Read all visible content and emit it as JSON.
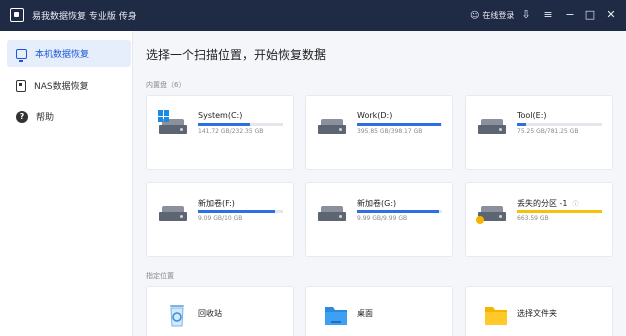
{
  "titlebar": {
    "app_title": "易我数据恢复 专业版 传身",
    "login": "在线登录"
  },
  "sidebar": {
    "items": [
      {
        "label": "本机数据恢复",
        "icon": "computer-icon"
      },
      {
        "label": "NAS数据恢复",
        "icon": "nas-icon"
      },
      {
        "label": "帮助",
        "icon": "help-icon"
      }
    ]
  },
  "main": {
    "title": "选择一个扫描位置，开始恢复数据",
    "disks_label": "内置盘（6）",
    "locations_label": "指定位置",
    "drives": [
      {
        "name": "System(C:)",
        "size": "141.72 GB/232.35 GB",
        "used_fraction": 0.61,
        "icon": "windows-drive-icon"
      },
      {
        "name": "Work(D:)",
        "size": "395.85 GB/398.17 GB",
        "used_fraction": 0.99,
        "icon": "drive-icon"
      },
      {
        "name": "Tool(E:)",
        "size": "75.25 GB/781.25 GB",
        "used_fraction": 0.1,
        "icon": "drive-icon"
      },
      {
        "name": "新加卷(F:)",
        "size": "9.09 GB/10 GB",
        "used_fraction": 0.91,
        "icon": "drive-icon"
      },
      {
        "name": "新加卷(G:)",
        "size": "9.99 GB/9.99 GB",
        "used_fraction": 0.96,
        "icon": "drive-icon"
      },
      {
        "name": "丢失的分区 -1",
        "size": "663.59 GB",
        "used_fraction": 1.0,
        "icon": "lost-partition-icon"
      }
    ],
    "locations": [
      {
        "name": "回收站",
        "icon": "recycle-bin-icon"
      },
      {
        "name": "桌面",
        "icon": "desktop-icon"
      },
      {
        "name": "选择文件夹",
        "icon": "folder-icon"
      }
    ]
  },
  "colors": {
    "titlebar": "#1f2a44",
    "accent": "#2f6fe4",
    "warning": "#f4c20d"
  }
}
